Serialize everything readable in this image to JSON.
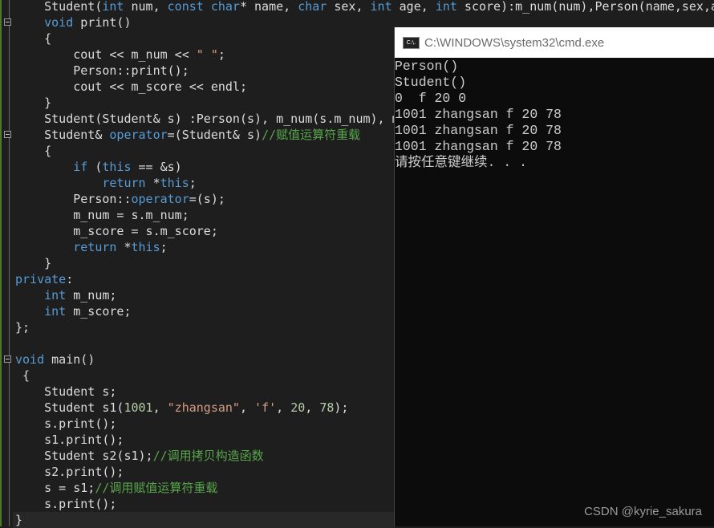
{
  "colors": {
    "keyword": "#569cd6",
    "string": "#d69d85",
    "comment": "#57a64a",
    "number": "#b5cea8",
    "text": "#dcdcdc",
    "editor_bg": "#1e1e1e",
    "console_bg": "#0c0c0c"
  },
  "editor": {
    "lines": [
      [
        [
          "    Student(",
          "pl"
        ],
        [
          "int",
          "kw"
        ],
        [
          " num, ",
          "pl"
        ],
        [
          "const",
          "kw"
        ],
        [
          " ",
          "pl"
        ],
        [
          "char",
          "kw"
        ],
        [
          "* name, ",
          "pl"
        ],
        [
          "char",
          "kw"
        ],
        [
          " sex, ",
          "pl"
        ],
        [
          "int",
          "kw"
        ],
        [
          " age, ",
          "pl"
        ],
        [
          "int",
          "kw"
        ],
        [
          " score):m_num(num),Person(name,sex,a",
          "pl"
        ]
      ],
      [
        [
          "    ",
          "pl"
        ],
        [
          "void",
          "kw"
        ],
        [
          " print()",
          "pl"
        ]
      ],
      [
        [
          "    {",
          "pl"
        ]
      ],
      [
        [
          "        cout << m_num << ",
          "pl"
        ],
        [
          "\" \"",
          "str"
        ],
        [
          ";",
          "pl"
        ]
      ],
      [
        [
          "        Person::print();",
          "pl"
        ]
      ],
      [
        [
          "        cout << m_score << endl;",
          "pl"
        ]
      ],
      [
        [
          "    }",
          "pl"
        ]
      ],
      [
        [
          "    Student(Student& s) :Person(s), m_num(s.m_num), m",
          "pl"
        ]
      ],
      [
        [
          "    Student& ",
          "pl"
        ],
        [
          "operator",
          "kw"
        ],
        [
          "=(Student& s)",
          "pl"
        ],
        [
          "//赋值运算符重载",
          "cm"
        ]
      ],
      [
        [
          "    {",
          "pl"
        ]
      ],
      [
        [
          "        ",
          "pl"
        ],
        [
          "if",
          "kw"
        ],
        [
          " (",
          "pl"
        ],
        [
          "this",
          "kw"
        ],
        [
          " == &s)",
          "pl"
        ]
      ],
      [
        [
          "            ",
          "pl"
        ],
        [
          "return",
          "kw"
        ],
        [
          " *",
          "pl"
        ],
        [
          "this",
          "kw"
        ],
        [
          ";",
          "pl"
        ]
      ],
      [
        [
          "        Person::",
          "pl"
        ],
        [
          "operator",
          "kw"
        ],
        [
          "=(s);",
          "pl"
        ]
      ],
      [
        [
          "        m_num = s.m_num;",
          "pl"
        ]
      ],
      [
        [
          "        m_score = s.m_score;",
          "pl"
        ]
      ],
      [
        [
          "        ",
          "pl"
        ],
        [
          "return",
          "kw"
        ],
        [
          " *",
          "pl"
        ],
        [
          "this",
          "kw"
        ],
        [
          ";",
          "pl"
        ]
      ],
      [
        [
          "    }",
          "pl"
        ]
      ],
      [
        [
          "private",
          "kw"
        ],
        [
          ":",
          "pl"
        ]
      ],
      [
        [
          "    ",
          "pl"
        ],
        [
          "int",
          "kw"
        ],
        [
          " m_num;",
          "pl"
        ]
      ],
      [
        [
          "    ",
          "pl"
        ],
        [
          "int",
          "kw"
        ],
        [
          " m_score;",
          "pl"
        ]
      ],
      [
        [
          "};",
          "pl"
        ]
      ],
      [
        [
          "",
          "pl"
        ]
      ],
      [
        [
          "void",
          "kw"
        ],
        [
          " main()",
          "pl"
        ]
      ],
      [
        [
          " {",
          "pl"
        ]
      ],
      [
        [
          "    Student s;",
          "pl"
        ]
      ],
      [
        [
          "    Student s1(",
          "pl"
        ],
        [
          "1001",
          "num"
        ],
        [
          ", ",
          "pl"
        ],
        [
          "\"zhangsan\"",
          "str"
        ],
        [
          ", ",
          "pl"
        ],
        [
          "'f'",
          "str"
        ],
        [
          ", ",
          "pl"
        ],
        [
          "20",
          "num"
        ],
        [
          ", ",
          "pl"
        ],
        [
          "78",
          "num"
        ],
        [
          ");",
          "pl"
        ]
      ],
      [
        [
          "    s.print();",
          "pl"
        ]
      ],
      [
        [
          "    s1.print();",
          "pl"
        ]
      ],
      [
        [
          "    Student s2(s1);",
          "pl"
        ],
        [
          "//调用拷贝构造函数",
          "cm"
        ]
      ],
      [
        [
          "    s2.print();",
          "pl"
        ]
      ],
      [
        [
          "    s = s1;",
          "pl"
        ],
        [
          "//调用赋值运算符重载",
          "cm"
        ]
      ],
      [
        [
          "    s.print();",
          "pl"
        ]
      ],
      [
        [
          "}",
          "pl"
        ]
      ]
    ]
  },
  "console": {
    "icon": "cmd-icon",
    "icon_text": "C:\\.",
    "title": "C:\\WINDOWS\\system32\\cmd.exe",
    "output": [
      "Person()",
      "Student()",
      "0  f 20 0",
      "1001 zhangsan f 20 78",
      "1001 zhangsan f 20 78",
      "1001 zhangsan f 20 78",
      "请按任意键继续. . ."
    ]
  },
  "watermark": "CSDN @kyrie_sakura"
}
